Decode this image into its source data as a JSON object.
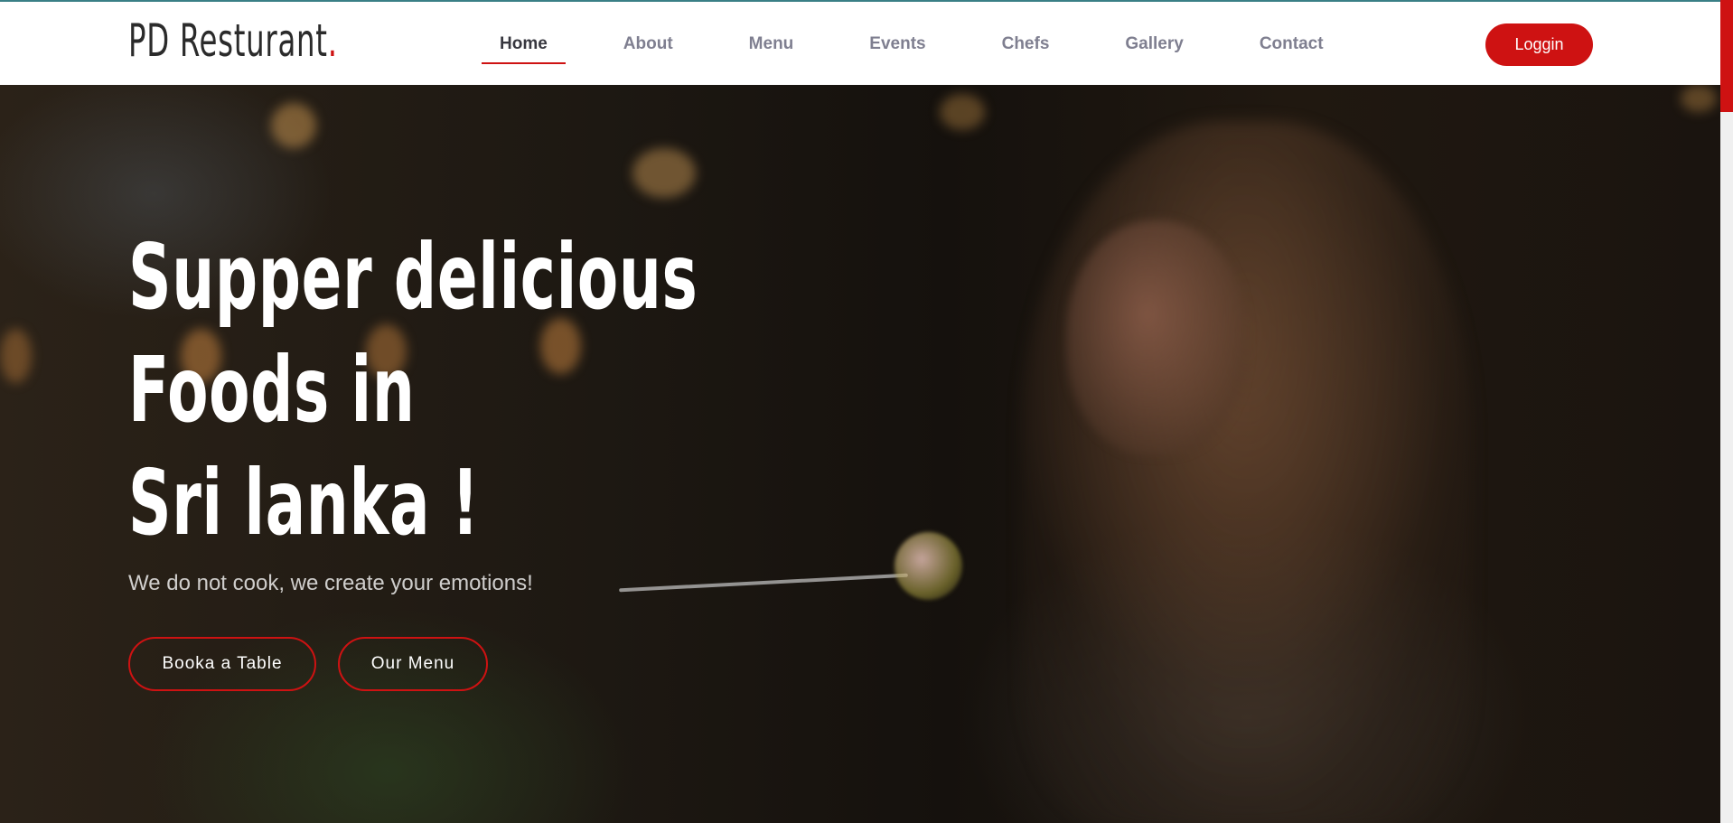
{
  "header": {
    "logo_text": "PD Resturant",
    "logo_dot": ".",
    "nav": [
      {
        "label": "Home",
        "active": true
      },
      {
        "label": "About",
        "active": false
      },
      {
        "label": "Menu",
        "active": false
      },
      {
        "label": "Events",
        "active": false
      },
      {
        "label": "Chefs",
        "active": false
      },
      {
        "label": "Gallery",
        "active": false
      },
      {
        "label": "Contact",
        "active": false
      }
    ],
    "login_label": "Loggin"
  },
  "hero": {
    "headline_lines": [
      "Supper delicious",
      "Foods in",
      "Sri lanka !"
    ],
    "subtitle": "We do not cook, we create your emotions!",
    "book_button": "Booka a Table",
    "menu_button": "Our Menu",
    "background_image": "woman-eating-in-restaurant-photo"
  },
  "colors": {
    "accent": "#ce1212",
    "nav_active": "#37373f",
    "nav_inactive": "#7f7f90"
  }
}
